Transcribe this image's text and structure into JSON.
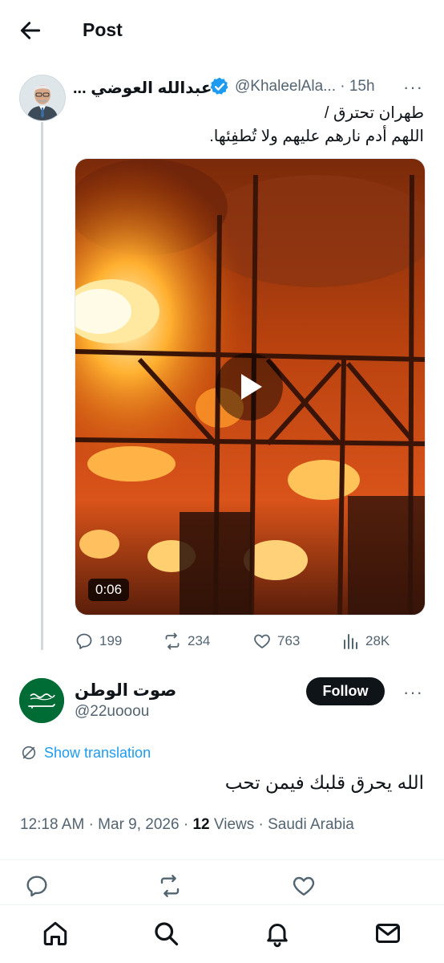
{
  "header": {
    "title": "Post"
  },
  "quoted_tweet": {
    "author_name": "... عبدالله العوضي",
    "handle": "@KhaleelAla...",
    "time": "· 15h",
    "more": "···",
    "text_line1": "طهران تحترق /",
    "text_line2": "اللهم أدم نارهم عليهم ولا تُطفِئها.",
    "video_duration": "0:06",
    "stats": {
      "replies": "199",
      "reposts": "234",
      "likes": "763",
      "views": "28K"
    }
  },
  "main_tweet": {
    "author_name": "صوت الوطن",
    "handle": "@22uooou",
    "follow_label": "Follow",
    "more": "···",
    "show_translation": "Show translation",
    "text": "الله يحرق قلبك فيمن تحب",
    "time": "12:18 AM",
    "date": "Mar 9, 2026",
    "views_count": "12",
    "views_label": "Views",
    "location": "Saudi Arabia"
  },
  "colors": {
    "link": "#1d9bf0",
    "verified": "#1d9bf0",
    "muted": "#536471",
    "saudi_green": "#006c35"
  }
}
